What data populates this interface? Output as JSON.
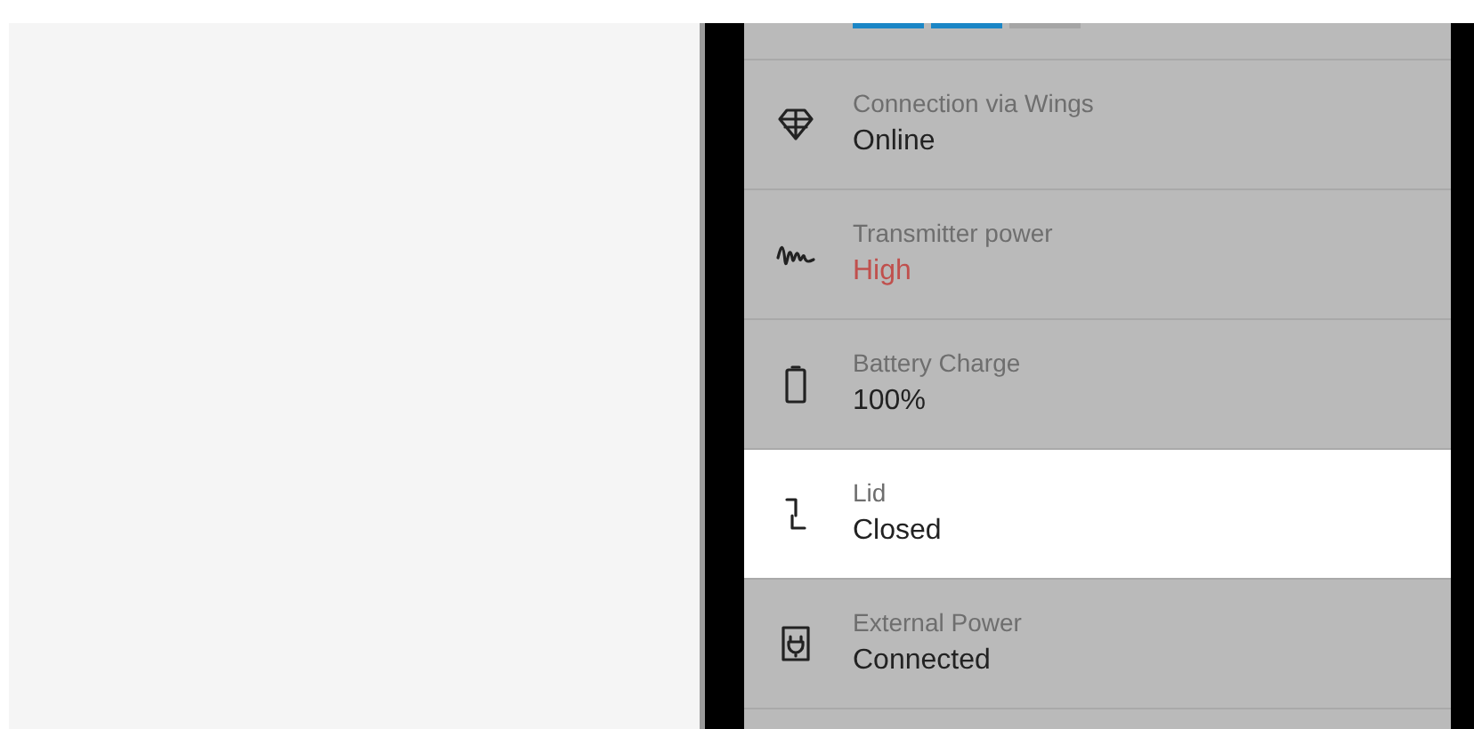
{
  "progress_segments": [
    {
      "filled": true
    },
    {
      "filled": true
    },
    {
      "filled": false
    }
  ],
  "status_items": [
    {
      "kind": "wings",
      "label": "Connection via Wings",
      "value": "Online",
      "color": "#222222",
      "highlighted": false
    },
    {
      "kind": "wave",
      "label": "Transmitter power",
      "value": "High",
      "color": "#c0504d",
      "highlighted": false
    },
    {
      "kind": "battery",
      "label": "Battery Charge",
      "value": "100%",
      "color": "#222222",
      "highlighted": false
    },
    {
      "kind": "lid",
      "label": "Lid",
      "value": "Closed",
      "color": "#222222",
      "highlighted": true
    },
    {
      "kind": "plug",
      "label": "External Power",
      "value": "Connected",
      "color": "#222222",
      "highlighted": false
    }
  ]
}
